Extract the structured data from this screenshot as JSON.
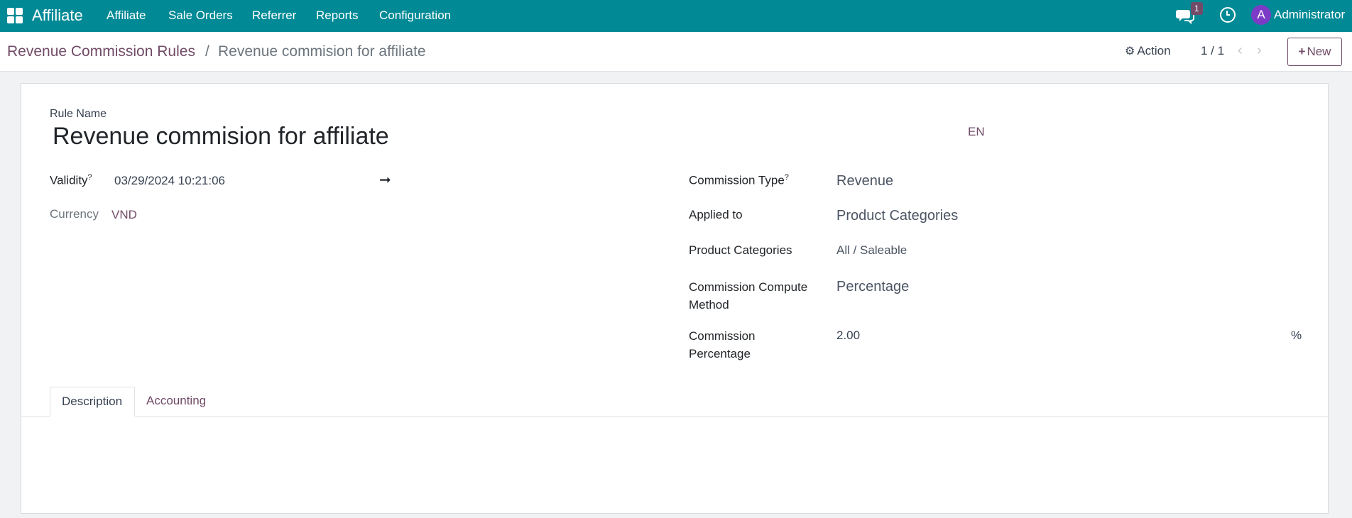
{
  "navbar": {
    "app_name": "Affiliate",
    "menu": [
      "Affiliate",
      "Sale Orders",
      "Referrer",
      "Reports",
      "Configuration"
    ],
    "messages_count": "1",
    "user_initial": "A",
    "user_name": "Administrator"
  },
  "breadcrumb": {
    "parent": "Revenue Commission Rules",
    "separator": "/",
    "current": "Revenue commision for affiliate"
  },
  "control": {
    "action_label": "Action",
    "pager": "1 / 1",
    "pager_prev": "‹",
    "pager_next": "›",
    "new_label": "New"
  },
  "form": {
    "rule_name_label": "Rule Name",
    "rule_name": "Revenue commision for affiliate",
    "lang": "EN",
    "validity_label": "Validity",
    "help_mark": "?",
    "validity_start": "03/29/2024 10:21:06",
    "arrow": "➞",
    "currency_label": "Currency",
    "currency": "VND",
    "commission_type_label": "Commission Type",
    "commission_type": "Revenue",
    "applied_to_label": "Applied to",
    "applied_to": "Product Categories",
    "product_categories_label": "Product Categories",
    "product_categories": "All / Saleable",
    "compute_method_label_1": "Commission Compute",
    "compute_method_label_2": "Method",
    "compute_method": "Percentage",
    "percentage_label_1": "Commission",
    "percentage_label_2": "Percentage",
    "percentage": "2.00",
    "percent_sign": "%"
  },
  "tabs": {
    "description": "Description",
    "accounting": "Accounting"
  },
  "colors": {
    "navbar": "#018a96",
    "brand_accent": "#714b67",
    "avatar": "#7c3bc7"
  }
}
